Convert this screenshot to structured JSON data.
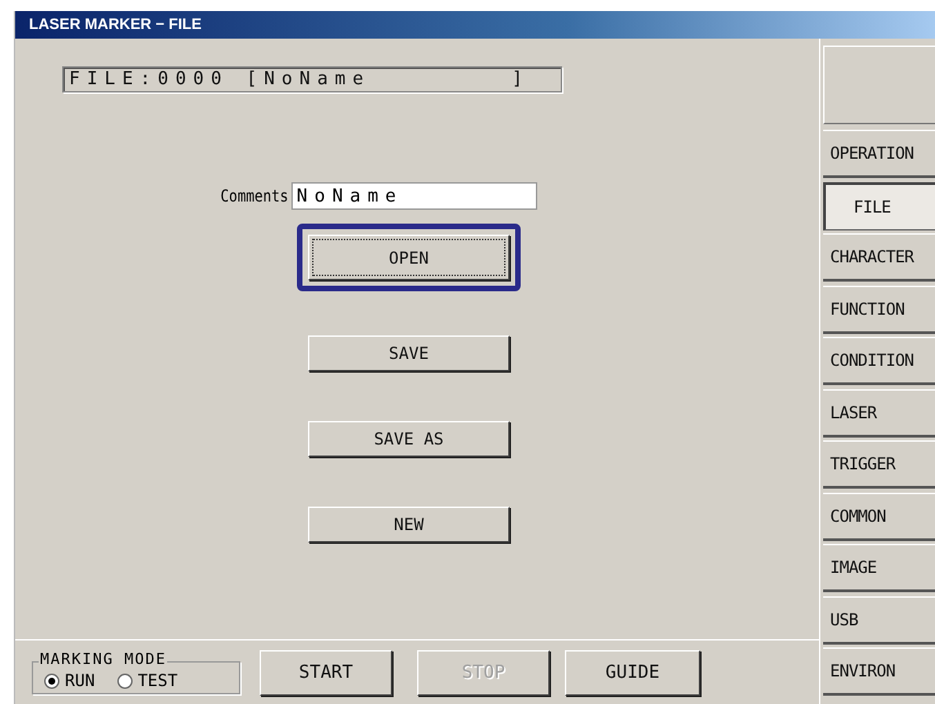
{
  "window": {
    "title": "LASER MARKER − FILE"
  },
  "file_label": "FILE:0000 [NoName        ]",
  "comments": {
    "label": "Comments",
    "value": "NoName"
  },
  "actions": [
    {
      "label": "OPEN",
      "focused": true
    },
    {
      "label": "SAVE",
      "focused": false
    },
    {
      "label": "SAVE AS",
      "focused": false
    },
    {
      "label": "NEW",
      "focused": false
    }
  ],
  "marking_mode": {
    "title": "MARKING MODE",
    "options": [
      {
        "label": "RUN",
        "selected": true
      },
      {
        "label": "TEST",
        "selected": false
      }
    ]
  },
  "bottom_buttons": [
    {
      "label": "START",
      "disabled": false
    },
    {
      "label": "STOP",
      "disabled": true
    },
    {
      "label": "GUIDE",
      "disabled": false
    }
  ],
  "sidebar": {
    "items": [
      {
        "label": "OPERATION",
        "selected": false
      },
      {
        "label": "FILE",
        "selected": true
      },
      {
        "label": "CHARACTER",
        "selected": false
      },
      {
        "label": "FUNCTION",
        "selected": false
      },
      {
        "label": "CONDITION",
        "selected": false
      },
      {
        "label": "LASER",
        "selected": false
      },
      {
        "label": "TRIGGER",
        "selected": false
      },
      {
        "label": "COMMON",
        "selected": false
      },
      {
        "label": "IMAGE",
        "selected": false
      },
      {
        "label": "USB",
        "selected": false
      },
      {
        "label": "ENVIRON",
        "selected": false
      }
    ]
  }
}
